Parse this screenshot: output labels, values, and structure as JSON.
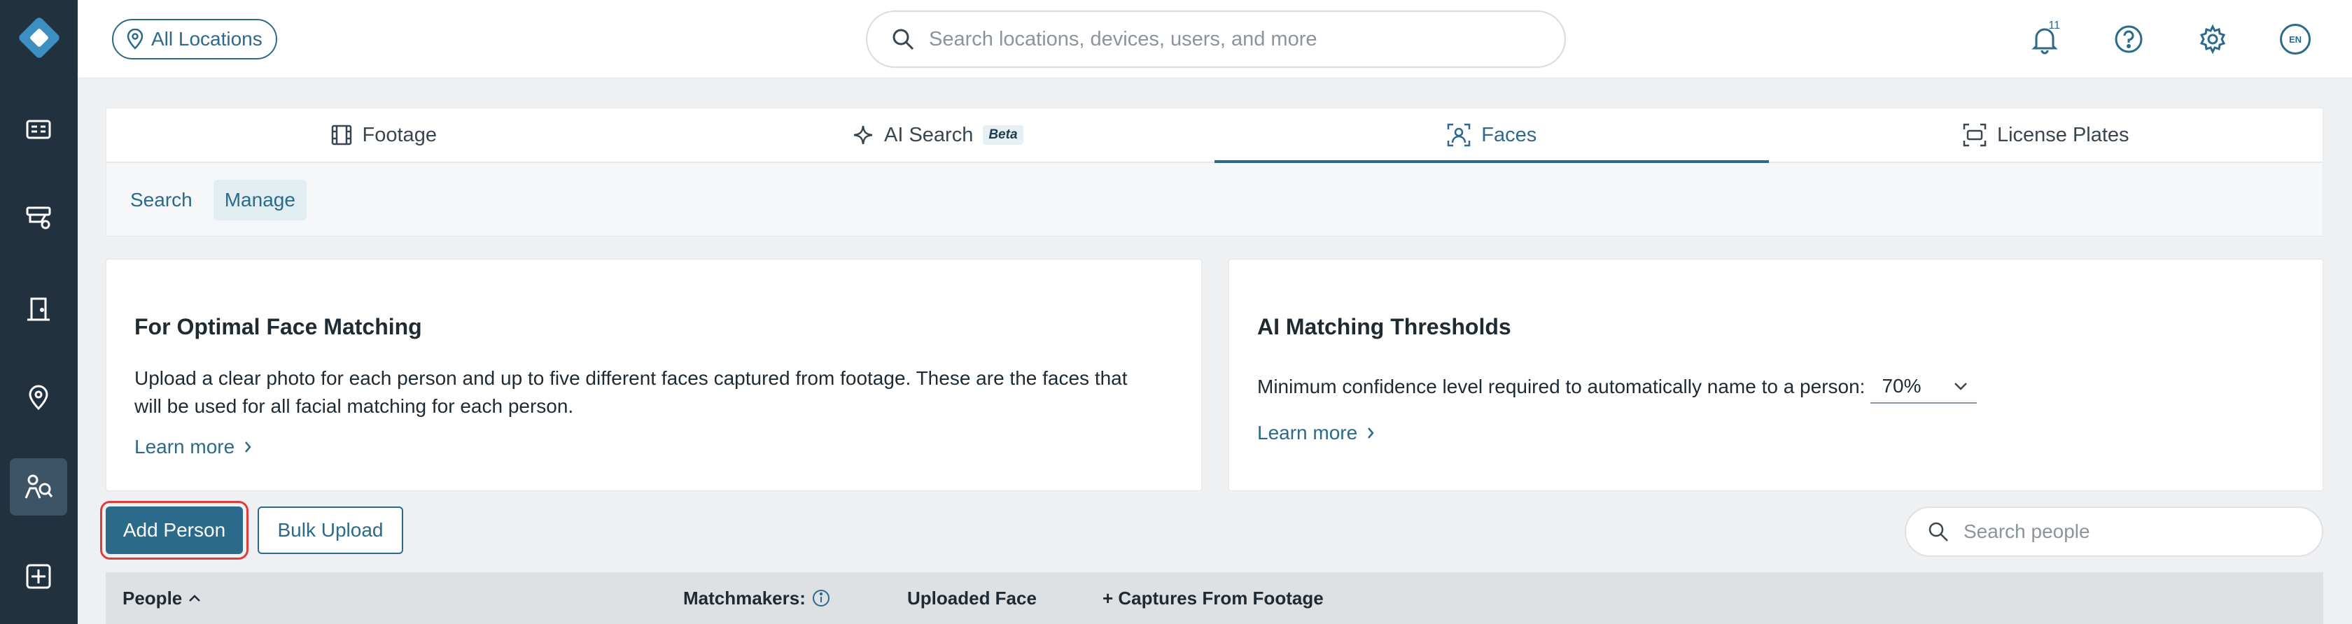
{
  "topbar": {
    "location_label": "All Locations",
    "search_placeholder": "Search locations, devices, users, and more",
    "notification_count": "11",
    "language": "EN"
  },
  "sidebar": {
    "items": [
      {
        "name": "dashboard",
        "icon": "dashboard-icon"
      },
      {
        "name": "cameras",
        "icon": "camera-icon"
      },
      {
        "name": "access",
        "icon": "door-icon"
      },
      {
        "name": "locations",
        "icon": "location-pin-icon"
      },
      {
        "name": "people-search",
        "icon": "person-search-icon",
        "active": true
      },
      {
        "name": "integrations",
        "icon": "integrations-icon"
      }
    ]
  },
  "tabs": [
    {
      "label": "Footage",
      "icon": "film-icon"
    },
    {
      "label": "AI Search",
      "icon": "sparkle-icon",
      "badge": "Beta"
    },
    {
      "label": "Faces",
      "icon": "face-scan-icon",
      "active": true
    },
    {
      "label": "License Plates",
      "icon": "license-plate-icon"
    }
  ],
  "subtabs": [
    {
      "label": "Search"
    },
    {
      "label": "Manage",
      "active": true
    }
  ],
  "cards": {
    "optimal": {
      "title": "For Optimal Face Matching",
      "body": "Upload a clear photo for each person and up to five different faces captured from footage. These are the faces that will be used for all facial matching for each person.",
      "learn_more": "Learn more"
    },
    "thresholds": {
      "title": "AI Matching Thresholds",
      "label": "Minimum confidence level required to automatically name to a person:",
      "value": "70%",
      "learn_more": "Learn more"
    }
  },
  "actions": {
    "add_person": "Add Person",
    "bulk_upload": "Bulk Upload",
    "search_people_placeholder": "Search people"
  },
  "table": {
    "headers": [
      "People",
      "Matchmakers:",
      "Uploaded Face",
      "+ Captures From Footage"
    ]
  },
  "colors": {
    "sidebar_bg": "#213140",
    "accent": "#2b6a8a",
    "highlight_outline": "#d9403a",
    "page_bg": "#eef0f2"
  }
}
